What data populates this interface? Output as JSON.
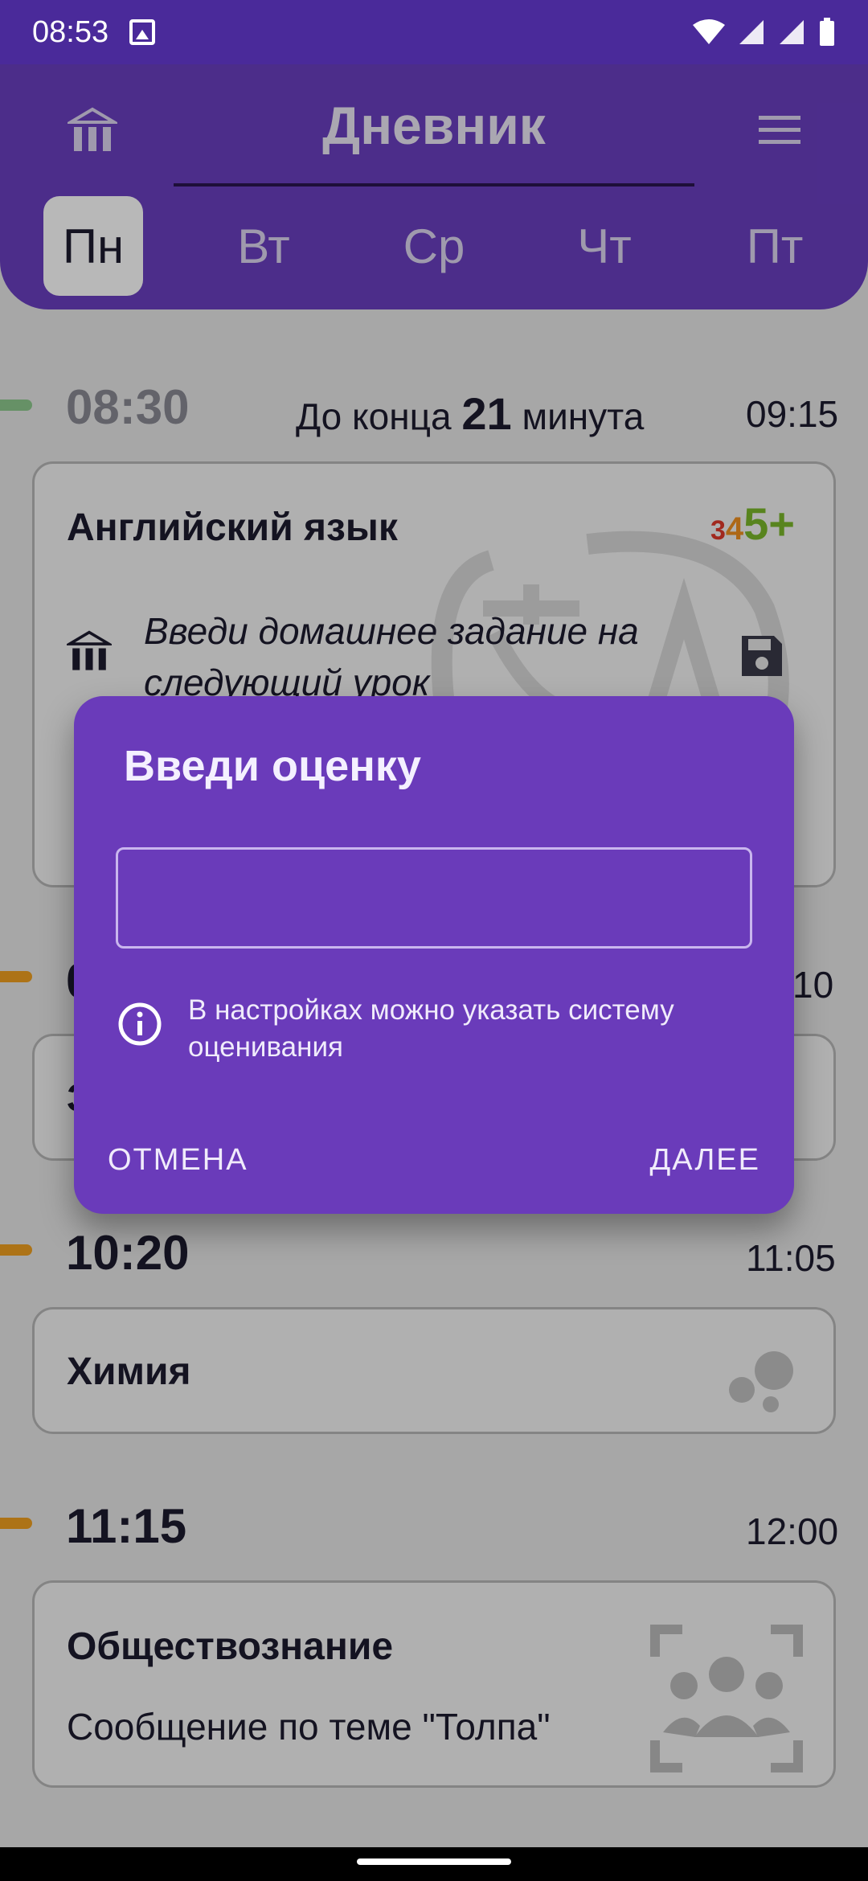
{
  "status_bar": {
    "time": "08:53"
  },
  "header": {
    "title": "Дневник"
  },
  "days": [
    "Пн",
    "Вт",
    "Ср",
    "Чт",
    "Пт"
  ],
  "active_day_index": 0,
  "current_lesson": {
    "start": "08:30",
    "countdown_prefix": "До конца",
    "countdown_value": "21",
    "countdown_suffix": "минута",
    "end": "09:15",
    "subject": "Английский язык",
    "grades": [
      "3",
      "4",
      "5+"
    ],
    "homework_placeholder": "Введи домашнее задание на следующий урок"
  },
  "lesson2": {
    "start_partial": "0",
    "end_partial": "10",
    "subject_partial": "З"
  },
  "lesson3": {
    "start": "10:20",
    "end": "11:05",
    "subject": "Химия"
  },
  "lesson4": {
    "start": "11:15",
    "end": "12:00",
    "subject": "Обществознание",
    "note": "Сообщение по теме \"Толпа\""
  },
  "dialog": {
    "title": "Введи оценку",
    "input_value": "",
    "hint": "В настройках можно указать систему оценивания",
    "cancel_label": "ОТМЕНА",
    "next_label": "ДАЛЕЕ"
  },
  "colors": {
    "accent": "#6a3fc0",
    "dialog_bg": "#6a3bba",
    "marker_green": "#8ec98e",
    "marker_orange": "#f0a020",
    "grade_3": "#e03a2a",
    "grade_4": "#f09020",
    "grade_5": "#7ab82a"
  }
}
